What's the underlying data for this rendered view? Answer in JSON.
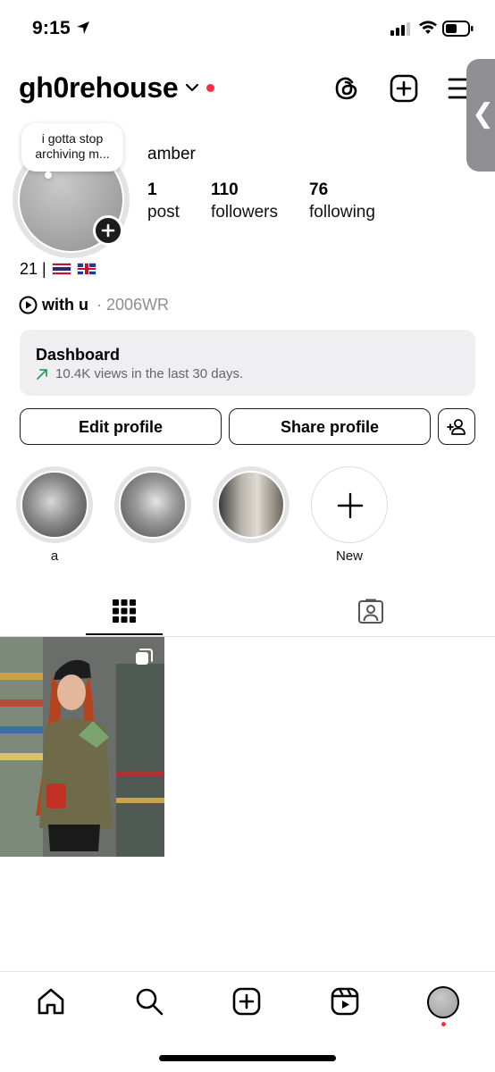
{
  "status_bar": {
    "time": "9:15"
  },
  "header": {
    "username": "gh0rehouse"
  },
  "profile": {
    "note": "i gotta stop archiving m...",
    "display_name": "amber",
    "stats": [
      {
        "value": "1",
        "label": "post"
      },
      {
        "value": "110",
        "label": "followers"
      },
      {
        "value": "76",
        "label": "following"
      }
    ],
    "bio_text": "21 |",
    "music_title": "with u",
    "music_artist": "· 2006WR"
  },
  "dashboard": {
    "title": "Dashboard",
    "subtitle": "10.4K views in the last 30 days."
  },
  "buttons": {
    "edit_profile": "Edit profile",
    "share_profile": "Share profile"
  },
  "highlights": [
    {
      "label": "a"
    },
    {
      "label": ""
    },
    {
      "label": ""
    },
    {
      "label": "New"
    }
  ],
  "colors": {
    "notification_dot": "#ff2d44",
    "trend_arrow": "#2e9e5b",
    "side_tab": "#8e8e93"
  },
  "icons": {
    "header": [
      "threads-icon",
      "create-post-icon",
      "menu-icon"
    ],
    "bottom_nav": [
      "home-icon",
      "search-icon",
      "create-icon",
      "reels-icon",
      "profile-avatar"
    ]
  }
}
